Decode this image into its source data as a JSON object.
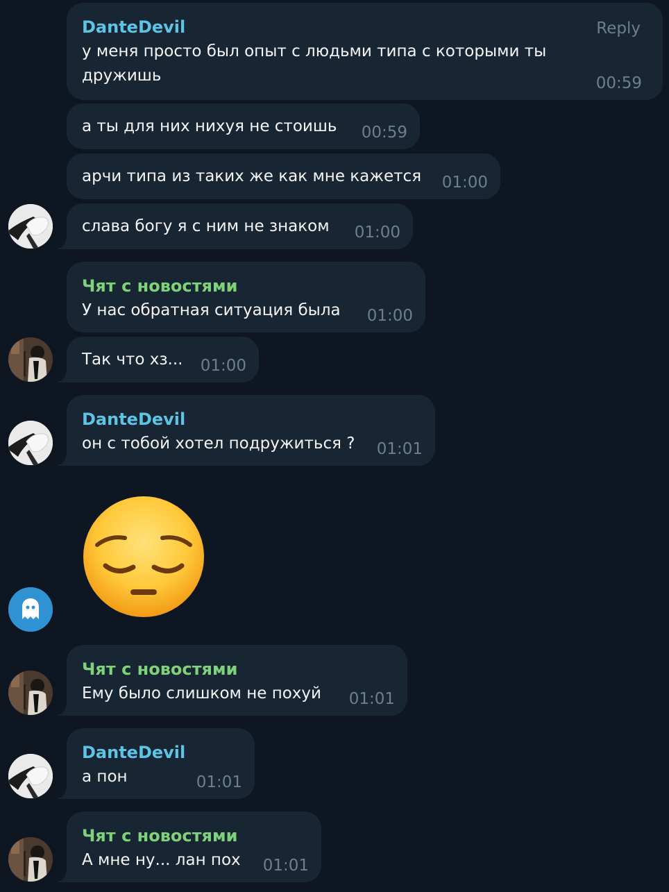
{
  "colors": {
    "background": "#0e1621",
    "bubble": "#182533",
    "sender_blue": "#5ec4e5",
    "sender_green": "#7fd17a",
    "time": "#6d7f8f",
    "text": "#f5f5f5"
  },
  "messages": [
    {
      "sender": "DanteDevil",
      "text": "у меня просто был опыт с людьми типа с которыми ты\nдружишь",
      "time": "00:59",
      "reply_label": "Reply"
    },
    {
      "text": "а ты для них нихуя не стоишь",
      "time": "00:59"
    },
    {
      "text": "арчи типа из таких же как мне кажется",
      "time": "01:00"
    },
    {
      "text": "слава богу я с ним не знаком",
      "time": "01:00",
      "avatar": "avatar-dantedevil"
    },
    {
      "sender": "Чят с новостями",
      "text": "У нас обратная ситуация была",
      "time": "01:00"
    },
    {
      "text": "Так что хз...",
      "time": "01:00",
      "avatar": "avatar-chyat"
    },
    {
      "sender": "DanteDevil",
      "text": "он с тобой хотел подружиться ?",
      "time": "01:01",
      "avatar": "avatar-dantedevil"
    },
    {
      "sticker": "pensive-face-emoji",
      "avatar": "ghost-icon"
    },
    {
      "sender": "Чят с новостями",
      "text": "Ему было слишком не похуй",
      "time": "01:01",
      "avatar": "avatar-chyat"
    },
    {
      "sender": "DanteDevil",
      "text": "а пон",
      "time": "01:01",
      "avatar": "avatar-dantedevil"
    },
    {
      "sender": "Чят с новостями",
      "text": "А мне ну... лан пох",
      "time": "01:01",
      "avatar": "avatar-chyat"
    }
  ]
}
